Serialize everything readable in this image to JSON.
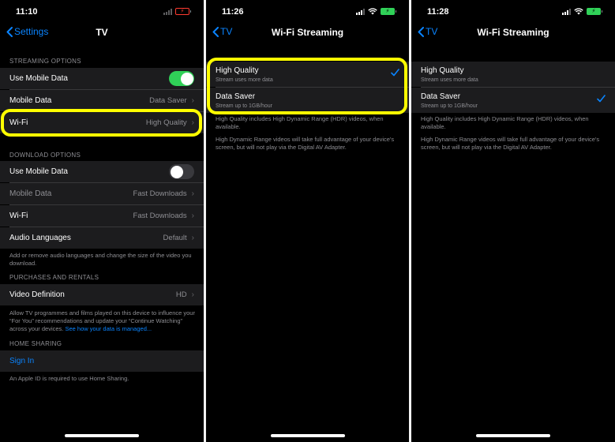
{
  "panel1": {
    "time": "11:10",
    "nav": {
      "back": "Settings",
      "title": "TV"
    },
    "streaming": {
      "header": "STREAMING OPTIONS",
      "use_mobile_data": "Use Mobile Data",
      "use_mobile_data_on": true,
      "mobile_data": {
        "label": "Mobile Data",
        "value": "Data Saver"
      },
      "wifi": {
        "label": "Wi-Fi",
        "value": "High Quality"
      }
    },
    "download": {
      "header": "DOWNLOAD OPTIONS",
      "use_mobile_data": "Use Mobile Data",
      "use_mobile_data_on": false,
      "mobile_data": {
        "label": "Mobile Data",
        "value": "Fast Downloads"
      },
      "wifi": {
        "label": "Wi-Fi",
        "value": "Fast Downloads"
      },
      "audio": {
        "label": "Audio Languages",
        "value": "Default"
      },
      "footer": "Add or remove audio languages and change the size of the video you download."
    },
    "purchases": {
      "header": "PURCHASES AND RENTALS",
      "video_def": {
        "label": "Video Definition",
        "value": "HD"
      },
      "footer": "Allow TV programmes and films played on this device to influence your “For You” recommendations and update your “Continue Watching” across your devices.",
      "footer_link": "See how your data is managed..."
    },
    "home_sharing": {
      "header": "HOME SHARING",
      "sign_in": "Sign In",
      "footer": "An Apple ID is required to use Home Sharing."
    }
  },
  "panel2": {
    "time": "11:26",
    "nav": {
      "back": "TV",
      "title": "Wi-Fi Streaming"
    },
    "options": [
      {
        "title": "High Quality",
        "subtitle": "Stream uses more data",
        "checked": true
      },
      {
        "title": "Data Saver",
        "subtitle": "Stream up to 1GB/hour",
        "checked": false
      }
    ],
    "note1": "High Quality includes High Dynamic Range (HDR) videos, when available.",
    "note2": "High Dynamic Range videos will take full advantage of your device's screen, but will not play via the Digital AV Adapter."
  },
  "panel3": {
    "time": "11:28",
    "nav": {
      "back": "TV",
      "title": "Wi-Fi Streaming"
    },
    "options": [
      {
        "title": "High Quality",
        "subtitle": "Stream uses more data",
        "checked": false
      },
      {
        "title": "Data Saver",
        "subtitle": "Stream up to 1GB/hour",
        "checked": true
      }
    ],
    "note1": "High Quality includes High Dynamic Range (HDR) videos, when available.",
    "note2": "High Dynamic Range videos will take full advantage of your device's screen, but will not play via the Digital AV Adapter."
  },
  "colors": {
    "accent": "#0a84ff",
    "toggle_on": "#30d158",
    "highlight": "#ffff00",
    "background": "#000000",
    "cell": "#1c1c1e"
  },
  "icons": [
    "chevron-left-icon",
    "chevron-right-icon",
    "checkmark-icon",
    "wifi-icon",
    "signal-icon",
    "battery-icon"
  ]
}
